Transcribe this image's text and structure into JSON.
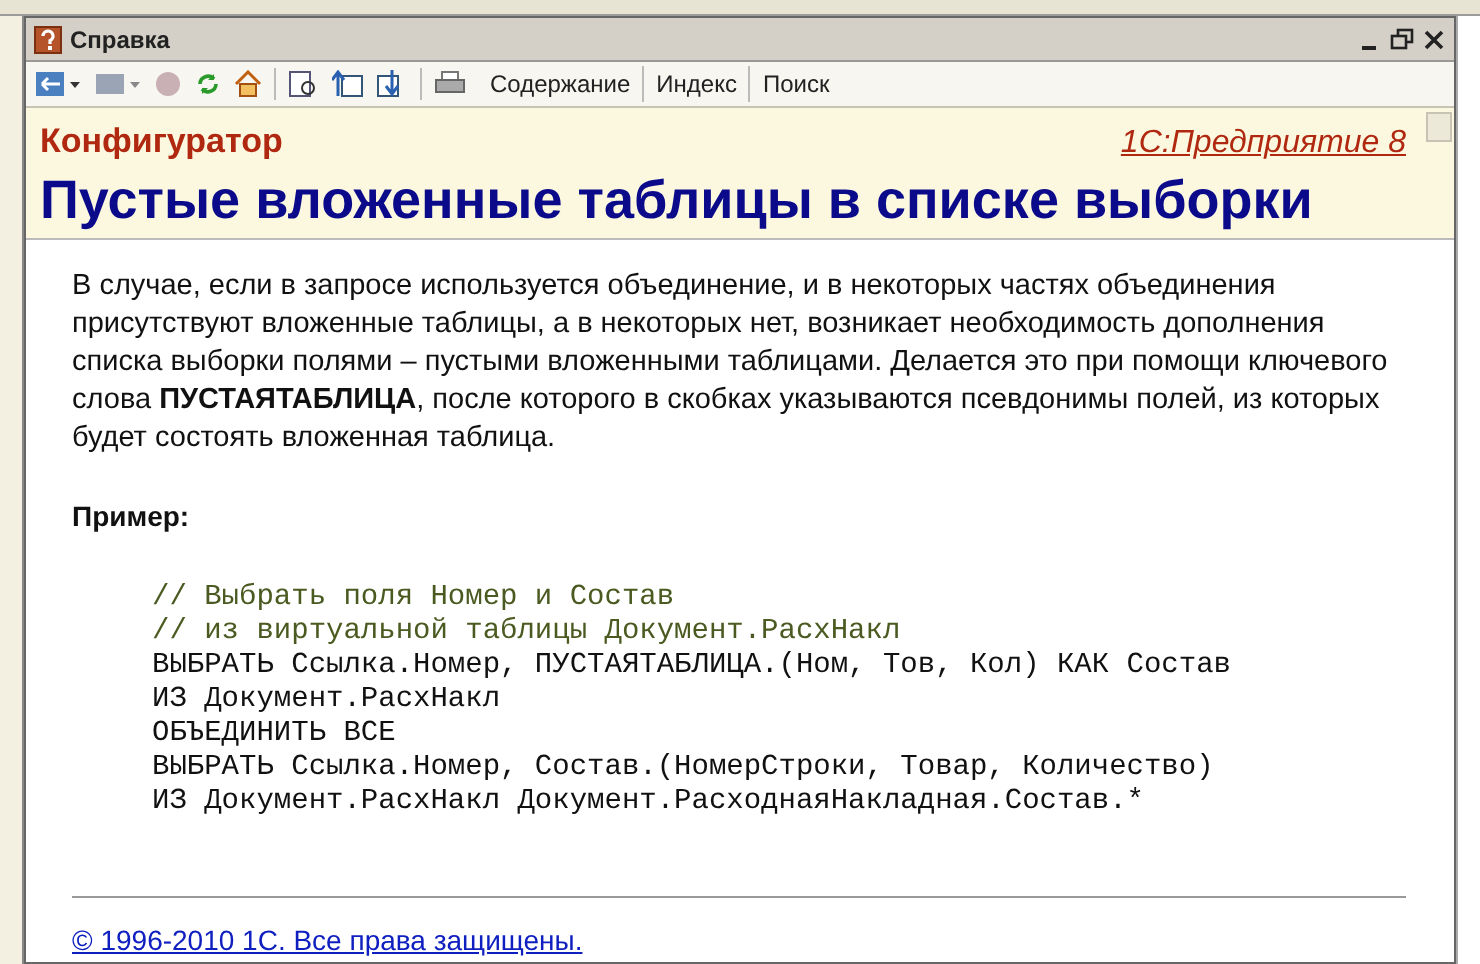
{
  "window": {
    "title": "Справка"
  },
  "toolbar": {
    "links": [
      "Содержание",
      "Индекс",
      "Поиск"
    ]
  },
  "header": {
    "section": "Конфигуратор",
    "product": "1С:Предприятие 8",
    "title": "Пустые вложенные таблицы в списке выборки"
  },
  "body": {
    "paragraph": "В случае, если в запросе используется объединение, и в некоторых частях объединения присутствуют вложенные таблицы, а в некоторых нет, возникает необходимость дополнения списка выборки полями – пустыми вложенными таблицами. Делается это при помощи ключевого слова **ПУСТАЯТАБЛИЦА**, после которого в скобках указываются псевдонимы полей, из которых будет состоять вложенная таблица.",
    "example_label": "Пример:",
    "code": [
      {
        "kind": "comment",
        "text": "// Выбрать поля Номер и Состав"
      },
      {
        "kind": "comment",
        "text": "// из виртуальной таблицы Документ.РасхНакл"
      },
      {
        "kind": "code",
        "text": "ВЫБРАТЬ Ссылка.Номер, ПУСТАЯТАБЛИЦА.(Ном, Тов, Кол) КАК Состав"
      },
      {
        "kind": "code",
        "text": "ИЗ Документ.РасхНакл"
      },
      {
        "kind": "code",
        "text": "ОБЪЕДИНИТЬ ВСЕ"
      },
      {
        "kind": "code",
        "text": "ВЫБРАТЬ Ссылка.Номер, Состав.(НомерСтроки, Товар, Количество)"
      },
      {
        "kind": "code",
        "text": "ИЗ Документ.РасхНакл Документ.РасходнаяНакладная.Состав.*"
      }
    ]
  },
  "footer": {
    "copyright": "© 1996-2010 1С. Все права защищены."
  }
}
